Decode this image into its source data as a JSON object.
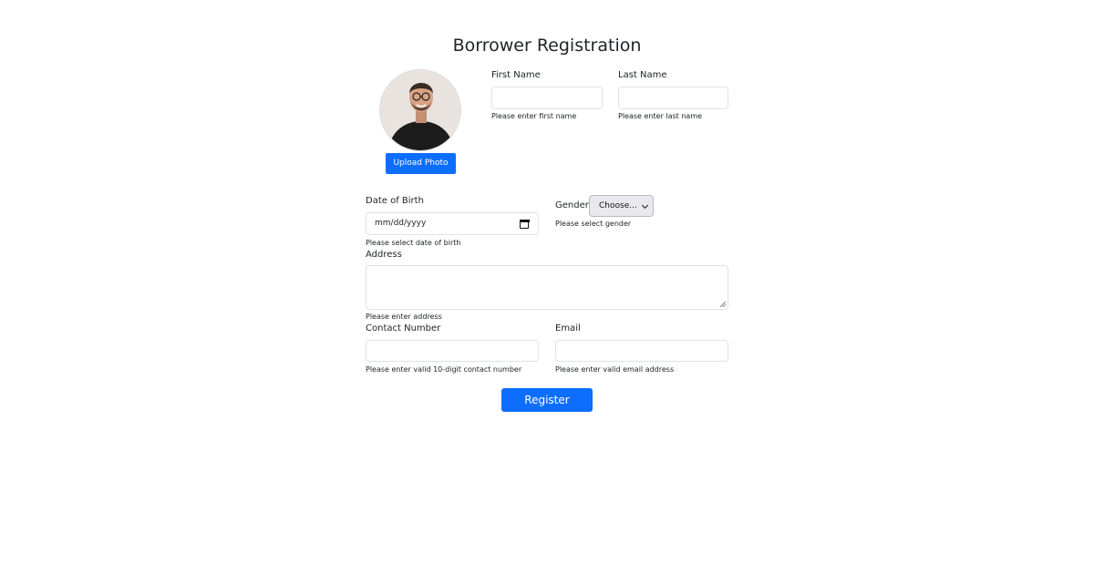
{
  "page": {
    "title": "Borrower Registration"
  },
  "photo": {
    "upload_label": "Upload Photo"
  },
  "fields": {
    "first_name": {
      "label": "First Name",
      "value": "",
      "hint": "Please enter first name"
    },
    "last_name": {
      "label": "Last Name",
      "value": "",
      "hint": "Please enter last name"
    },
    "dob": {
      "label": "Date of Birth",
      "placeholder": "mm/dd/yyyy",
      "hint": "Please select date of birth"
    },
    "gender": {
      "label": "Gender",
      "selected": "Choose...",
      "hint": "Please select gender"
    },
    "address": {
      "label": "Address",
      "value": "",
      "hint": "Please enter address"
    },
    "contact": {
      "label": "Contact Number",
      "value": "",
      "hint": "Please enter valid 10-digit contact number"
    },
    "email": {
      "label": "Email",
      "value": "",
      "hint": "Please enter valid email address"
    }
  },
  "actions": {
    "register_label": "Register"
  },
  "colors": {
    "primary": "#0d6efd",
    "border": "#dee2e6",
    "text": "#212529"
  }
}
